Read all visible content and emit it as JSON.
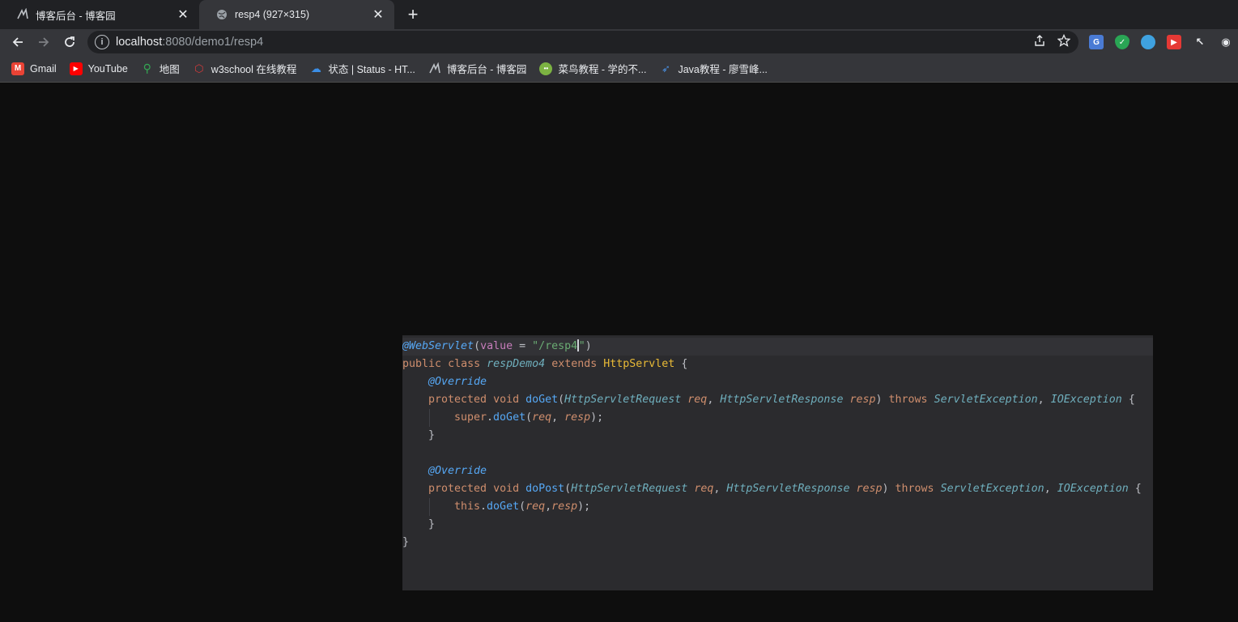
{
  "tabs": [
    {
      "title": "博客后台 - 博客园",
      "favicon": "cnblogs-icon",
      "active": false
    },
    {
      "title": "resp4 (927×315)",
      "favicon": "globe-icon",
      "active": true
    }
  ],
  "toolbar": {
    "url_host": "localhost",
    "url_rest": ":8080/demo1/resp4"
  },
  "bookmarks": [
    {
      "label": "Gmail",
      "icon": "gmail-icon",
      "color": "#ea4335"
    },
    {
      "label": "YouTube",
      "icon": "youtube-icon",
      "color": "#ff0000"
    },
    {
      "label": "地图",
      "icon": "maps-icon",
      "color": "#34a853"
    },
    {
      "label": "w3school 在线教程",
      "icon": "w3school-icon",
      "color": "#d33b3b"
    },
    {
      "label": "状态 | Status - HT...",
      "icon": "cloud-icon",
      "color": "#3b8ee6"
    },
    {
      "label": "博客后台 - 博客园",
      "icon": "cnblogs-icon",
      "color": "#bdc1c6"
    },
    {
      "label": "菜鸟教程 - 学的不...",
      "icon": "runoob-icon",
      "color": "#7cb342"
    },
    {
      "label": "Java教程 - 廖雪峰...",
      "icon": "rocket-icon",
      "color": "#4a90e2"
    }
  ],
  "code": {
    "annotation_servlet": "@WebServlet",
    "servlet_value_key": "value",
    "servlet_value": "\"/resp4\"",
    "kw_public": "public",
    "kw_class": "class",
    "class_name": "respDemo4",
    "kw_extends": "extends",
    "super_class": "HttpServlet",
    "override": "@Override",
    "kw_protected": "protected",
    "kw_void": "void",
    "method_get": "doGet",
    "method_post": "doPost",
    "type_req": "HttpServletRequest",
    "type_resp": "HttpServletResponse",
    "param_req": "req",
    "param_resp": "resp",
    "kw_throws": "throws",
    "ex1": "ServletException",
    "ex2": "IOException",
    "kw_super": "super",
    "kw_this": "this"
  }
}
